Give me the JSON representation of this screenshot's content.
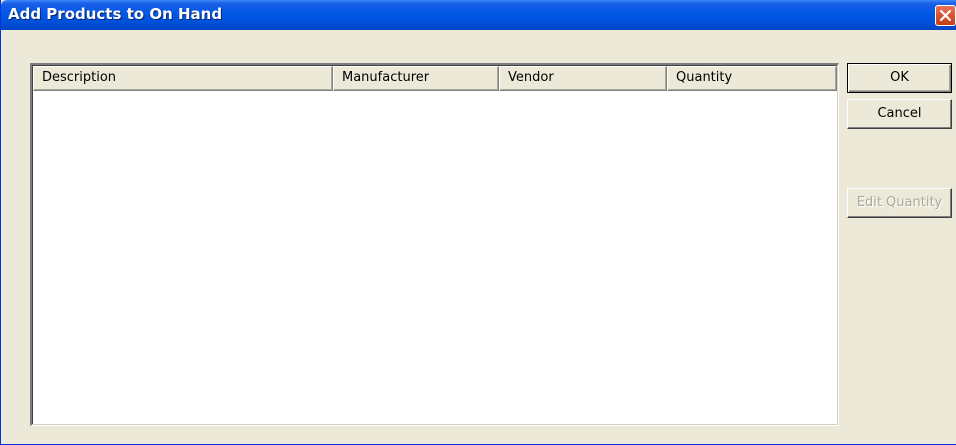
{
  "window": {
    "title": "Add Products to On Hand"
  },
  "list": {
    "columns": [
      "Description",
      "Manufacturer",
      "Vendor",
      "Quantity"
    ],
    "rows": []
  },
  "buttons": {
    "ok_label": "OK",
    "cancel_label": "Cancel",
    "edit_quantity_label": "Edit Quantity"
  },
  "colors": {
    "titlebar": "#0058e6",
    "dialog_background": "#ece9d8",
    "close_button": "#d9522d",
    "disabled_text": "#aca899"
  },
  "icons": {
    "close": "close-icon"
  }
}
